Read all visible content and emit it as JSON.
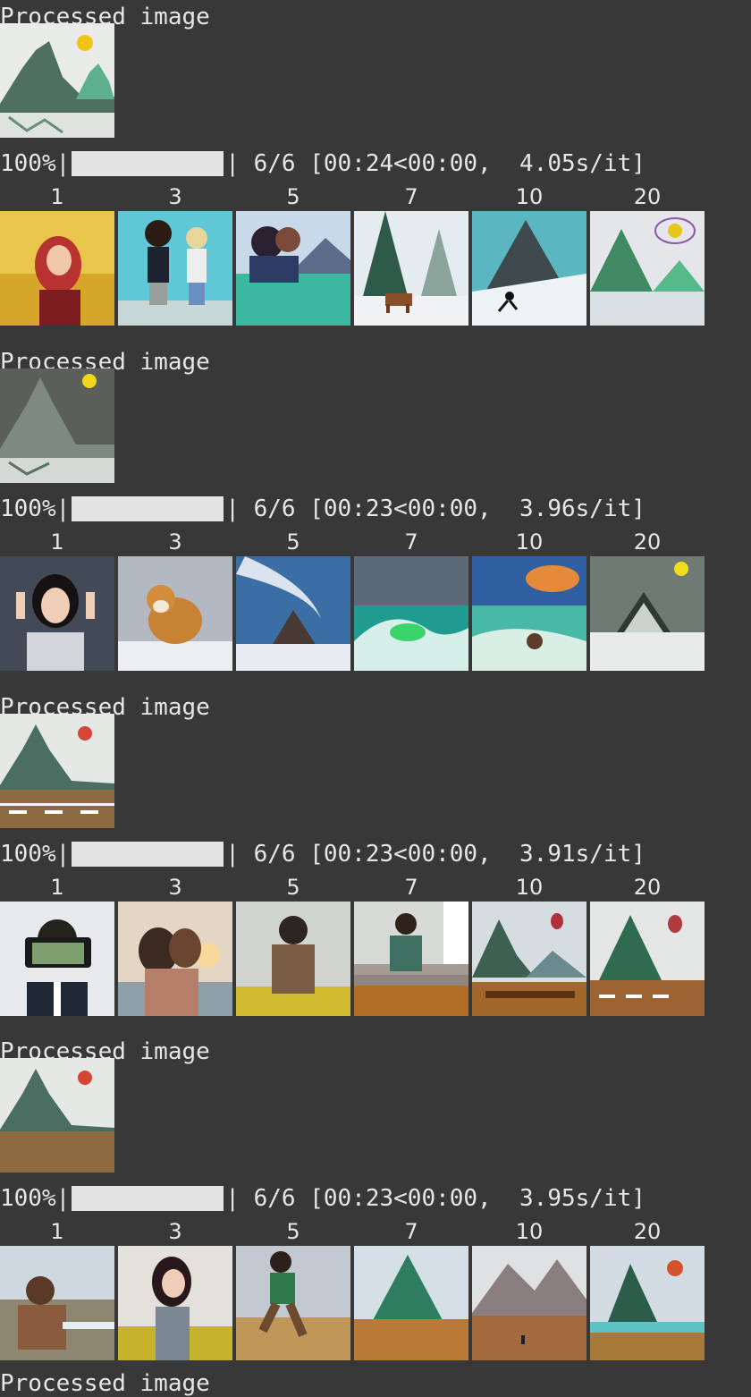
{
  "processed_label": "Processed image",
  "blocks": [
    {
      "processed_image": "mountain-lake-sun",
      "progress": {
        "percent": "100%",
        "count": "6/6",
        "timing": "[00:24<00:00,  4.05s/it]",
        "fraction": 1.0
      },
      "columns": [
        "1",
        "3",
        "5",
        "7",
        "10",
        "20"
      ],
      "thumbnails": [
        "woman-red-hair-field",
        "couple-walking",
        "couple-lake",
        "trees-horse-snow",
        "mountain-snow-skier",
        "mountain-lake-sun-swirls"
      ]
    },
    {
      "processed_image": "mountain-stars-sun",
      "progress": {
        "percent": "100%",
        "count": "6/6",
        "timing": "[00:23<00:00,  3.96s/it]",
        "fraction": 1.0
      },
      "columns": [
        "1",
        "3",
        "5",
        "7",
        "10",
        "20"
      ],
      "thumbnails": [
        "woman-glasses",
        "shiba-dog-snow",
        "tornado-mountain",
        "ocean-wave",
        "sunset-ocean-wave",
        "cabin-snow-sun"
      ]
    },
    {
      "processed_image": "mountain-road-red-sun",
      "progress": {
        "percent": "100%",
        "count": "6/6",
        "timing": "[00:23<00:00,  3.91s/it]",
        "fraction": 1.0
      },
      "columns": [
        "1",
        "3",
        "5",
        "7",
        "10",
        "20"
      ],
      "thumbnails": [
        "man-holding-phone",
        "couple-kissing-sunset",
        "man-flowers",
        "man-sitting-steps",
        "mountain-balloon-bench",
        "mountain-balloon-road"
      ]
    },
    {
      "processed_image": "mountain-ground-red-sun",
      "progress": {
        "percent": "100%",
        "count": "6/6",
        "timing": "[00:23<00:00,  3.95s/it]",
        "fraction": 1.0
      },
      "columns": [
        "1",
        "3",
        "5",
        "7",
        "10",
        "20"
      ],
      "thumbnails": [
        "man-in-sea",
        "woman-flowers",
        "man-jumping-field",
        "mountain-field",
        "mountain-plain-figure",
        "mountain-island-sun"
      ]
    }
  ],
  "trailing_label": "Processed image"
}
